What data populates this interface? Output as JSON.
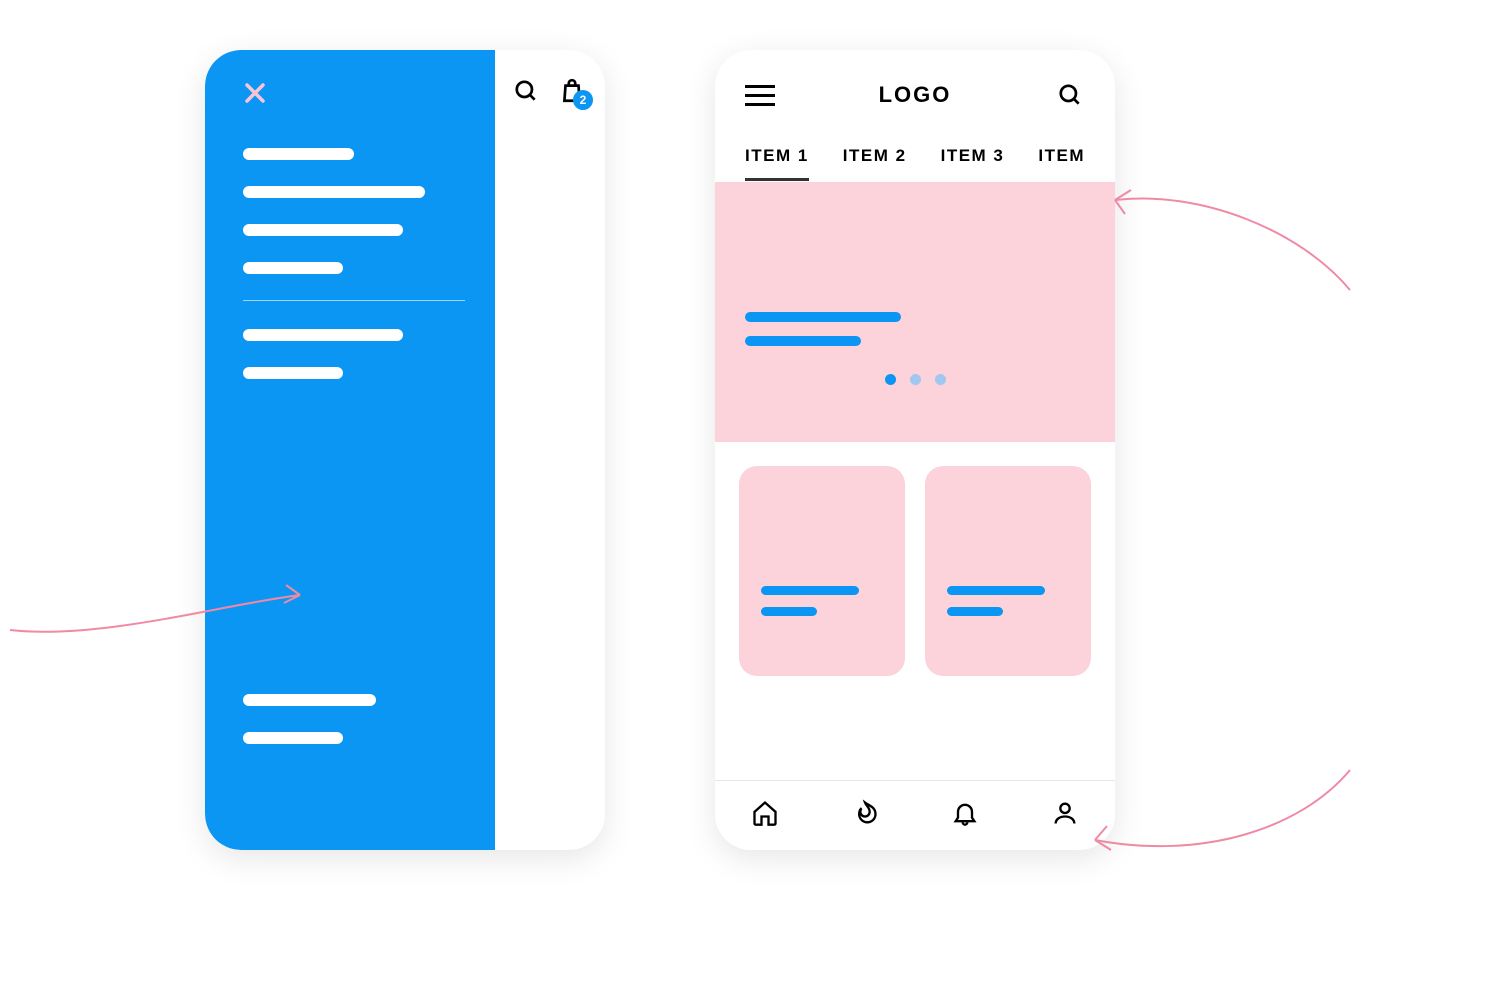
{
  "colors": {
    "accent": "#0a96f2",
    "pink": "#fcd2db",
    "arrow": "#f08aa4",
    "closeIcon": "#f9c5d5"
  },
  "leftPhone": {
    "cart_badge": "2",
    "drawer": {
      "primary_items_count": 4,
      "secondary_items_count": 2,
      "footer_items_count": 2
    }
  },
  "rightPhone": {
    "logo": "LOGO",
    "tabs": [
      "ITEM 1",
      "ITEM 2",
      "ITEM 3",
      "ITEM"
    ],
    "active_tab_index": 0,
    "hero": {
      "dots": 3,
      "active_dot": 0
    },
    "bottom_nav": [
      "home",
      "fire",
      "bell",
      "user"
    ]
  }
}
